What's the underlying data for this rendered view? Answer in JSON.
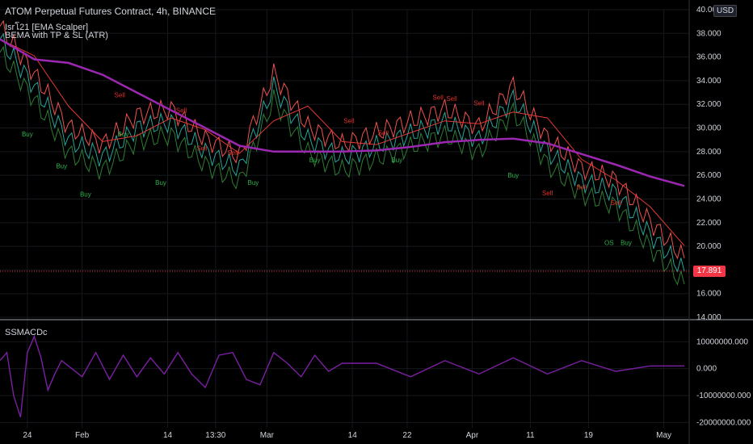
{
  "legend": {
    "title": "ATOM Perpetual Futures Contract, 4h, BINANCE",
    "indicator1": "Isrโ21 [EMA Scalper]",
    "indicator2": "BEMA with TP & SL (ATR)",
    "indicator3": "SSMACDc"
  },
  "currency_badge": "USD",
  "last_price_label": "17.891",
  "colors": {
    "background": "#000000",
    "slow_ema": "#9c27b0",
    "fast_ema": "#e53935",
    "band": "#ef5350",
    "green_line": "#2e7d32",
    "price_candles": "#26a69a",
    "macd": "#7b1fa2",
    "last_price": "#f23645",
    "text": "#d1d4dc"
  },
  "signals": {
    "buy": "Buy",
    "sell": "Sell",
    "os": "OS"
  },
  "chart_data": [
    {
      "type": "line",
      "title": "ATOM Perpetual Futures Contract, 4h, BINANCE",
      "price_axis": {
        "ylim": [
          14,
          40
        ],
        "ticks": [
          "14.000",
          "16.000",
          "18.000",
          "20.000",
          "22.000",
          "24.000",
          "26.000",
          "28.000",
          "30.000",
          "32.000",
          "34.000",
          "36.000",
          "38.000",
          "40.000"
        ]
      },
      "x_ticks": [
        "24",
        "Feb",
        "14",
        "13:30",
        "Mar",
        "14",
        "22",
        "Apr",
        "11",
        "19",
        "May"
      ],
      "series": [
        {
          "x": [
            0,
            5,
            10,
            15,
            20,
            25,
            30,
            35,
            40,
            45,
            50,
            55,
            60,
            65,
            70,
            75,
            80,
            85,
            90,
            95,
            100
          ],
          "values": [
            37.5,
            33.5,
            29,
            27.5,
            30,
            30.5,
            28,
            26.5,
            33.5,
            29,
            27.5,
            28.5,
            29.5,
            30.5,
            29,
            32.5,
            28,
            25.5,
            24.5,
            21,
            17.9
          ]
        },
        {
          "x": [
            0,
            5,
            10,
            15,
            20,
            25,
            30,
            35,
            40,
            45,
            50,
            55,
            60,
            65,
            70,
            75,
            80,
            85,
            90,
            95,
            100
          ],
          "values": [
            37.5,
            35.8,
            35.5,
            34.5,
            33,
            31.5,
            30,
            28.5,
            28,
            28,
            28,
            28.1,
            28.4,
            28.8,
            29,
            29.1,
            28.7,
            27.8,
            26.9,
            25.9,
            25.1
          ]
        }
      ],
      "signals": [
        {
          "label": "Buy",
          "x": 4,
          "y": 29.3
        },
        {
          "label": "Buy",
          "x": 9,
          "y": 26.6
        },
        {
          "label": "Buy",
          "x": 12.5,
          "y": 24.2
        },
        {
          "label": "Sell",
          "x": 17.5,
          "y": 32.6
        },
        {
          "label": "Buy",
          "x": 18,
          "y": 29.3
        },
        {
          "label": "Buy",
          "x": 23.5,
          "y": 25.2
        },
        {
          "label": "Sell",
          "x": 26.5,
          "y": 31.3
        },
        {
          "label": "Sell",
          "x": 29.5,
          "y": 28.1
        },
        {
          "label": "Sell",
          "x": 34,
          "y": 27.7
        },
        {
          "label": "Buy",
          "x": 37,
          "y": 25.2
        },
        {
          "label": "Buy",
          "x": 46,
          "y": 27.1
        },
        {
          "label": "Sell",
          "x": 51,
          "y": 30.4
        },
        {
          "label": "Sell",
          "x": 56,
          "y": 29.4
        },
        {
          "label": "Buy",
          "x": 58,
          "y": 27.1
        },
        {
          "label": "Sell",
          "x": 64,
          "y": 32.4
        },
        {
          "label": "Sell",
          "x": 66,
          "y": 32.3
        },
        {
          "label": "Sell",
          "x": 70,
          "y": 31.9
        },
        {
          "label": "Buy",
          "x": 75,
          "y": 25.8
        },
        {
          "label": "Sell",
          "x": 80,
          "y": 24.3
        },
        {
          "label": "Sell",
          "x": 85,
          "y": 24.8
        },
        {
          "label": "Sell",
          "x": 90,
          "y": 23.5
        },
        {
          "label": "OS",
          "x": 89,
          "y": 20.1
        },
        {
          "label": "Buy",
          "x": 91.5,
          "y": 20.1
        }
      ],
      "last_price": 17.891
    },
    {
      "type": "line",
      "title": "SSMACDc",
      "y_ticks": [
        "10000000.000",
        "0.000",
        "-10000000.000",
        "-20000000.000"
      ],
      "ylim": [
        -22000000,
        14000000
      ],
      "series": [
        {
          "x": [
            0,
            1,
            2,
            3,
            4,
            5,
            6,
            7,
            8,
            9,
            10,
            12,
            14,
            16,
            18,
            20,
            22,
            24,
            26,
            28,
            30,
            32,
            34,
            36,
            38,
            40,
            42,
            44,
            46,
            48,
            50,
            55,
            60,
            65,
            70,
            75,
            80,
            85,
            90,
            95,
            100
          ],
          "values": [
            3000000,
            6000000,
            -10000000,
            -18000000,
            6000000,
            12000000,
            4000000,
            -8000000,
            -2000000,
            3000000,
            1000000,
            -3000000,
            6000000,
            -4000000,
            5000000,
            -3000000,
            4000000,
            -2000000,
            6000000,
            -2000000,
            -7000000,
            5000000,
            6000000,
            -4000000,
            -6000000,
            6000000,
            2000000,
            -3000000,
            5000000,
            -1000000,
            2000000,
            2000000,
            -3000000,
            3000000,
            -2000000,
            4000000,
            -2000000,
            3000000,
            -1000000,
            1000000,
            1000000
          ]
        }
      ]
    }
  ]
}
